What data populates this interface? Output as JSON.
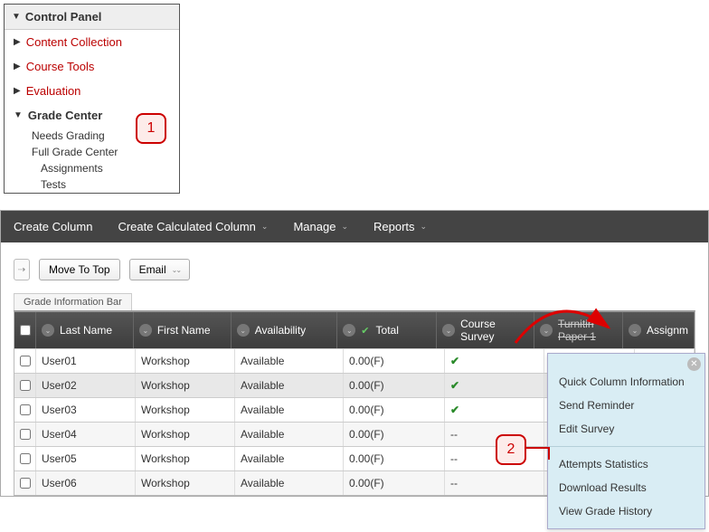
{
  "control_panel": {
    "title": "Control Panel",
    "items": [
      {
        "label": "Content Collection",
        "expanded": false
      },
      {
        "label": "Course Tools",
        "expanded": false
      },
      {
        "label": "Evaluation",
        "expanded": false
      },
      {
        "label": "Grade Center",
        "expanded": true
      }
    ],
    "grade_center_children": [
      {
        "label": "Needs Grading",
        "indent": 1
      },
      {
        "label": "Full Grade Center",
        "indent": 1
      },
      {
        "label": "Assignments",
        "indent": 2
      },
      {
        "label": "Tests",
        "indent": 2
      }
    ]
  },
  "callouts": {
    "one": "1",
    "two": "2"
  },
  "toolbar": {
    "create_column": "Create Column",
    "create_calc": "Create Calculated Column",
    "manage": "Manage",
    "reports": "Reports"
  },
  "buttons": {
    "move_to_top": "Move To Top",
    "email": "Email"
  },
  "info_bar": "Grade Information Bar",
  "columns": {
    "last_name": "Last Name",
    "first_name": "First Name",
    "availability": "Availability",
    "total": "Total",
    "course_survey": "Course Survey",
    "turnitin": "Turnitin Paper 1",
    "assign": "Assignm"
  },
  "rows": [
    {
      "last": "User01",
      "first": "Workshop",
      "avail": "Available",
      "total": "0.00(F)",
      "survey": "check"
    },
    {
      "last": "User02",
      "first": "Workshop",
      "avail": "Available",
      "total": "0.00(F)",
      "survey": "check",
      "selected": true
    },
    {
      "last": "User03",
      "first": "Workshop",
      "avail": "Available",
      "total": "0.00(F)",
      "survey": "check"
    },
    {
      "last": "User04",
      "first": "Workshop",
      "avail": "Available",
      "total": "0.00(F)",
      "survey": "--"
    },
    {
      "last": "User05",
      "first": "Workshop",
      "avail": "Available",
      "total": "0.00(F)",
      "survey": "--"
    },
    {
      "last": "User06",
      "first": "Workshop",
      "avail": "Available",
      "total": "0.00(F)",
      "survey": "--"
    }
  ],
  "context_menu": {
    "group1": [
      "Quick Column Information",
      "Send Reminder",
      "Edit Survey"
    ],
    "group2": [
      "Attempts Statistics",
      "Download Results",
      "View Grade History"
    ]
  }
}
